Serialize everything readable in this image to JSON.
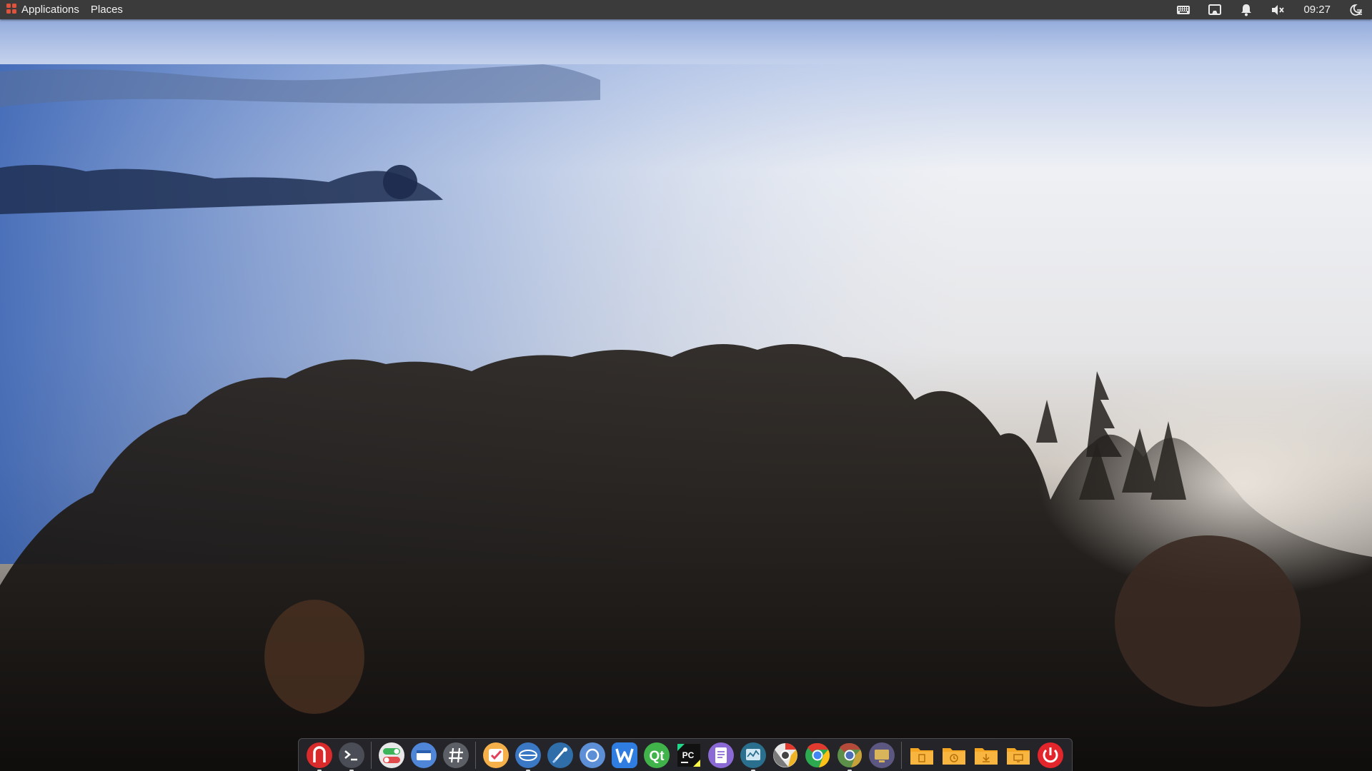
{
  "top_panel": {
    "menu": {
      "applications_label": "Applications",
      "places_label": "Places"
    },
    "tray": {
      "icons": [
        "keyboard-icon",
        "display-icon",
        "notification-bell-icon",
        "volume-muted-icon",
        "night-light-icon"
      ],
      "clock": "09:27"
    }
  },
  "dock": {
    "groups": [
      [
        "terminal-red-app-icon",
        "terminal-app-icon"
      ],
      [
        "toggle-app-icon",
        "window-manager-app-icon",
        "hashtag-app-icon"
      ],
      [
        "tasks-app-icon",
        "remote-desktop-app-icon",
        "pycharm-alt-app-icon",
        "search-app-icon",
        "wps-writer-app-icon",
        "qt-creator-app-icon",
        "pycharm-app-icon",
        "text-editor-app-icon",
        "system-monitor-app-icon",
        "chrome-canary-app-icon",
        "chrome-app-icon",
        "chromium-app-icon",
        "monitor-app-icon"
      ],
      [
        "documents-folder-icon",
        "recent-folder-icon",
        "downloads-folder-icon",
        "desktop-folder-icon",
        "power-icon"
      ]
    ]
  },
  "colors": {
    "panel_bg": "#3b3b3b",
    "panel_text": "#f2f2f2",
    "dock_bg": "rgba(40,42,48,0.82)",
    "power_red": "#e3262c",
    "folder_orange": "#f5a623"
  }
}
